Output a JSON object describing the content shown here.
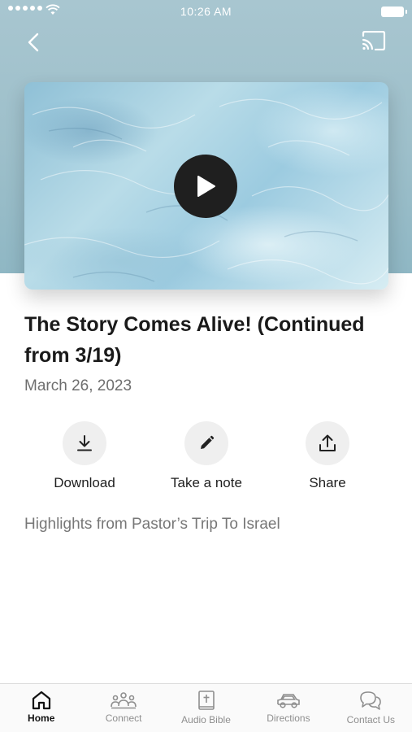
{
  "status_bar": {
    "time": "10:26 AM"
  },
  "media": {
    "title": "The Story Comes Alive! (Continued from 3/19)",
    "date": "March 26, 2023",
    "description": "Highlights from Pastor’s Trip To Israel"
  },
  "actions": [
    {
      "label": "Download",
      "icon": "download-icon"
    },
    {
      "label": "Take a note",
      "icon": "pencil-icon"
    },
    {
      "label": "Share",
      "icon": "share-icon"
    }
  ],
  "tabs": [
    {
      "label": "Home",
      "icon": "home-icon",
      "active": true
    },
    {
      "label": "Connect",
      "icon": "people-icon",
      "active": false
    },
    {
      "label": "Audio Bible",
      "icon": "bible-icon",
      "active": false
    },
    {
      "label": "Directions",
      "icon": "car-icon",
      "active": false
    },
    {
      "label": "Contact Us",
      "icon": "chat-icon",
      "active": false
    }
  ],
  "colors": {
    "accent": "#1f1f1f",
    "inactive_tab": "#8e8e8e",
    "hero_bg": "#9dbfca"
  }
}
